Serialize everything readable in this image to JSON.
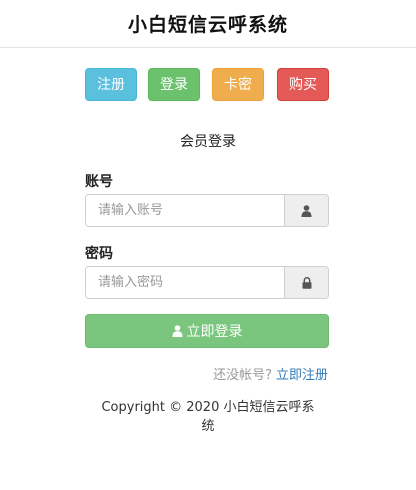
{
  "header": {
    "title": "小白短信云呼系统"
  },
  "nav": {
    "register": "注册",
    "login": "登录",
    "card_key": "卡密",
    "buy": "购买"
  },
  "form": {
    "title": "会员登录",
    "username_label": "账号",
    "username_placeholder": "请输入账号",
    "username_value": "",
    "password_label": "密码",
    "password_placeholder": "请输入密码",
    "password_value": "",
    "submit_label": "立即登录",
    "user_icon": "user-icon",
    "lock_icon": "lock-icon"
  },
  "register_prompt": {
    "text": "还没帐号?",
    "link": "立即注册"
  },
  "footer": {
    "copyright": "Copyright © 2020 小白短信云呼系统"
  },
  "colors": {
    "info": "#5bc0de",
    "success": "#6cc26c",
    "warning": "#f0ad4e",
    "danger": "#e35a57",
    "login_button": "#7bc67e",
    "link": "#337ab7"
  }
}
